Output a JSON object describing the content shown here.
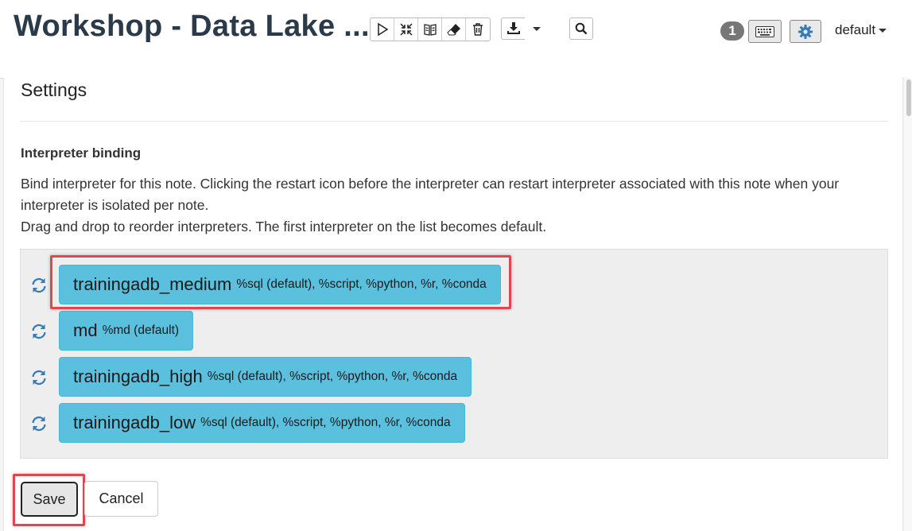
{
  "header": {
    "title": "Workshop - Data Lake ...",
    "toolbar": {
      "buttons": [
        {
          "name": "run-all-button",
          "icon": "play-icon"
        },
        {
          "name": "show-hide-code-button",
          "icon": "collapse-arrows-icon"
        },
        {
          "name": "show-hide-output-button",
          "icon": "book-icon"
        },
        {
          "name": "clear-output-button",
          "icon": "eraser-icon"
        },
        {
          "name": "remove-note-button",
          "icon": "trash-icon"
        }
      ],
      "export_icon": "download-icon",
      "search_icon": "search-icon"
    },
    "badge_count": "1",
    "keyboard_icon": "keyboard-icon",
    "settings_icon": "gear-icon",
    "user": "default"
  },
  "settings": {
    "title": "Settings",
    "binding_title": "Interpreter binding",
    "description_line1": "Bind interpreter for this note. Clicking the restart icon before the interpreter can restart interpreter associated with this note when your interpreter is isolated per note.",
    "description_line2": "Drag and drop to reorder interpreters. The first interpreter on the list becomes default.",
    "interpreters": [
      {
        "name": "trainingadb_medium",
        "aliases": "%sql (default), %script, %python, %r, %conda"
      },
      {
        "name": "md",
        "aliases": "%md (default)"
      },
      {
        "name": "trainingadb_high",
        "aliases": "%sql (default), %script, %python, %r, %conda"
      },
      {
        "name": "trainingadb_low",
        "aliases": "%sql (default), %script, %python, %r, %conda"
      }
    ],
    "save_label": "Save",
    "cancel_label": "Cancel"
  },
  "colors": {
    "interpreter_bg": "#5bc0de",
    "highlight": "#e0464e",
    "restart_icon": "#337ab7"
  }
}
